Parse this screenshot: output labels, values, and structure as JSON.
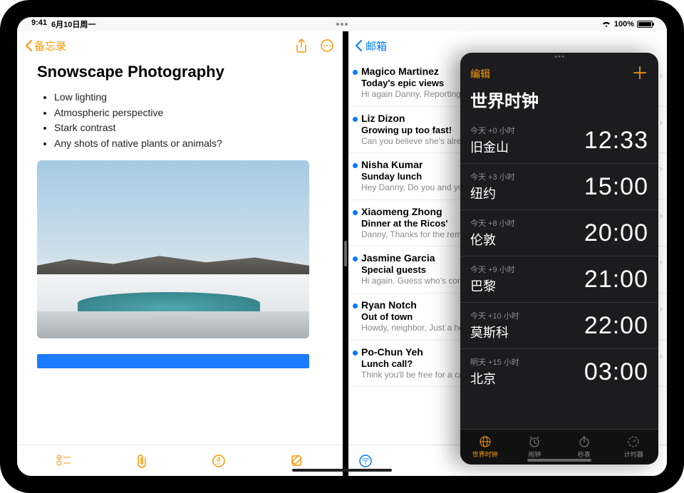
{
  "status": {
    "time": "9:41",
    "date": "6月10日周一",
    "battery": "100%"
  },
  "notes": {
    "back_label": "备忘录",
    "title": "Snowscape Photography",
    "bullets": [
      "Low lighting",
      "Atmospheric perspective",
      "Stark contrast",
      "Any shots of native plants or animals?"
    ]
  },
  "mail": {
    "back_label": "邮箱",
    "messages": [
      {
        "from": "Magico Martinez",
        "subject": "Today's epic views",
        "preview": "Hi again Danny, Reporting in again from the field. Wide open skies, a ge…"
      },
      {
        "from": "Liz Dizon",
        "subject": "Growing up too fast!",
        "preview": "Can you believe she's already…"
      },
      {
        "from": "Nisha Kumar",
        "subject": "Sunday lunch",
        "preview": "Hey Danny, Do you and your dad? If you two join, th…"
      },
      {
        "from": "Xiaomeng Zhong",
        "subject": "Dinner at the Ricos'",
        "preview": "Danny, Thanks for the reminder, remembered to take o…"
      },
      {
        "from": "Jasmine Garcia",
        "subject": "Special guests",
        "preview": "Hi again. Guess who's coming? I know how to make me…"
      },
      {
        "from": "Ryan Notch",
        "subject": "Out of town",
        "preview": "Howdy, neighbor, Just a heads up, leaving Tuesday and…"
      },
      {
        "from": "Po-Chun Yeh",
        "subject": "Lunch call?",
        "preview": "Think you'll be free for a call? Let me know what you think might work a…"
      }
    ]
  },
  "clock": {
    "edit_label": "编辑",
    "title": "世界时钟",
    "rows": [
      {
        "offset": "今天 +0 小时",
        "city": "旧金山",
        "time": "12:33"
      },
      {
        "offset": "今天 +3 小时",
        "city": "纽约",
        "time": "15:00"
      },
      {
        "offset": "今天 +8 小时",
        "city": "伦敦",
        "time": "20:00"
      },
      {
        "offset": "今天 +9 小时",
        "city": "巴黎",
        "time": "21:00"
      },
      {
        "offset": "今天 +10 小时",
        "city": "莫斯科",
        "time": "22:00"
      },
      {
        "offset": "明天 +15 小时",
        "city": "北京",
        "time": "03:00"
      }
    ],
    "tabs": {
      "world": "世界时钟",
      "alarm": "闹钟",
      "stopwatch": "秒表",
      "timer": "计时器"
    }
  }
}
